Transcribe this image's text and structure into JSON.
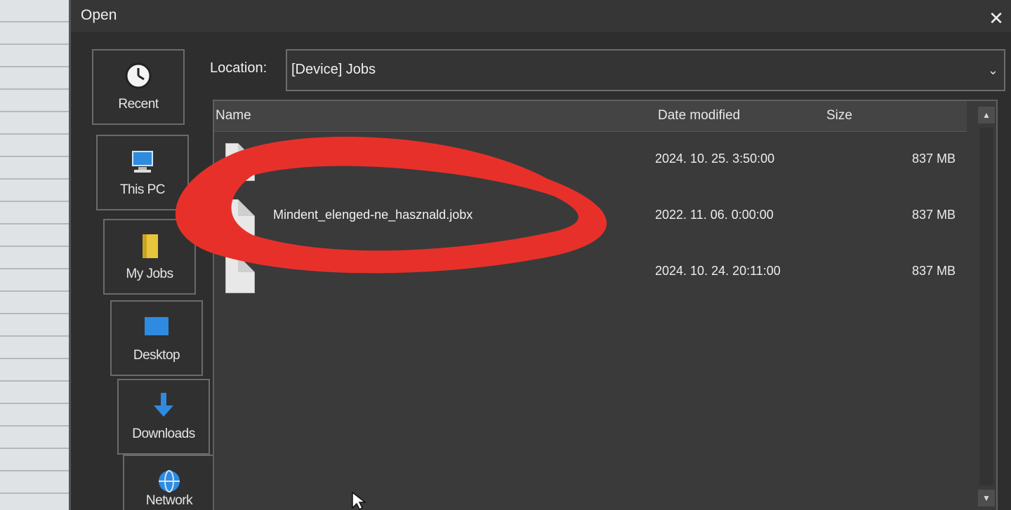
{
  "dialog": {
    "title": "Open",
    "close_glyph": "✕"
  },
  "sidebar": {
    "items": [
      {
        "label": "Recent",
        "icon": "clock-icon"
      },
      {
        "label": "This PC",
        "icon": "computer-icon"
      },
      {
        "label": "My Jobs",
        "icon": "folder-icon"
      },
      {
        "label": "Desktop",
        "icon": "desktop-icon"
      },
      {
        "label": "Downloads",
        "icon": "download-arrow-icon"
      },
      {
        "label": "Network",
        "icon": "network-globe-icon"
      }
    ]
  },
  "location": {
    "label": "Location:",
    "value": "[Device] Jobs",
    "chevron": "⌄"
  },
  "file_list": {
    "columns": {
      "name": "Name",
      "date": "Date modified",
      "size": "Size"
    },
    "rows": [
      {
        "name": "",
        "date": "2024. 10. 25. 3:50:00",
        "size": "837 MB"
      },
      {
        "name": "Mindent_elenged-ne_hasznald.jobx",
        "date": "2022. 11. 06. 0:00:00",
        "size": "837 MB"
      },
      {
        "name": "",
        "date": "2024. 10. 24. 20:11:00",
        "size": "837 MB"
      }
    ]
  },
  "scrollbar": {
    "up": "▲",
    "down": "▼"
  },
  "colors": {
    "dialog_bg": "#2e2e2e",
    "list_bg": "#3a3a3a",
    "annotation_red": "#e8302a",
    "accent_blue": "#2f8be0",
    "folder_yellow": "#e8c53a"
  }
}
